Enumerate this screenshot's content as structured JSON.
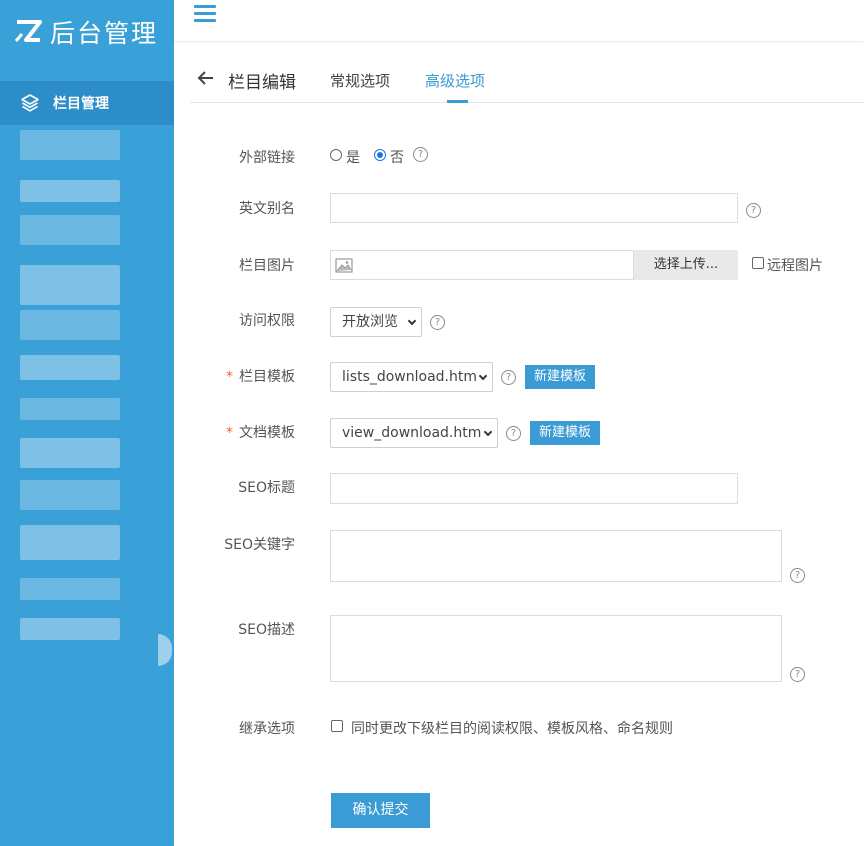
{
  "app": {
    "title": "后台管理"
  },
  "sidebar": {
    "active_item": "栏目管理"
  },
  "tabs": {
    "page_title": "栏目编辑",
    "tab1": "常规选项",
    "tab2": "高级选项"
  },
  "form": {
    "external_link": {
      "label": "外部链接",
      "yes": "是",
      "no": "否",
      "selected": "否"
    },
    "english_alias": {
      "label": "英文别名",
      "value": ""
    },
    "category_image": {
      "label": "栏目图片",
      "upload_button": "选择上传...",
      "remote_label": "远程图片"
    },
    "access": {
      "label": "访问权限",
      "value": "开放浏览"
    },
    "list_template": {
      "label": "栏目模板",
      "required": "*",
      "value": "lists_download.htm",
      "new_button": "新建模板"
    },
    "doc_template": {
      "label": "文档模板",
      "required": "*",
      "value": "view_download.htm",
      "new_button": "新建模板"
    },
    "seo_title": {
      "label": "SEO标题",
      "value": ""
    },
    "seo_keywords": {
      "label": "SEO关键字",
      "value": ""
    },
    "seo_description": {
      "label": "SEO描述",
      "value": ""
    },
    "inherit": {
      "label": "继承选项",
      "checkbox_text": "同时更改下级栏目的阅读权限、模板风格、命名规则"
    },
    "submit": "确认提交"
  },
  "help_glyph": "?",
  "colors": {
    "sidebar": "#3aa0d8",
    "sidebar_active": "#2d8dc9",
    "accent": "#3a9bd5",
    "required": "#e96d2e"
  }
}
